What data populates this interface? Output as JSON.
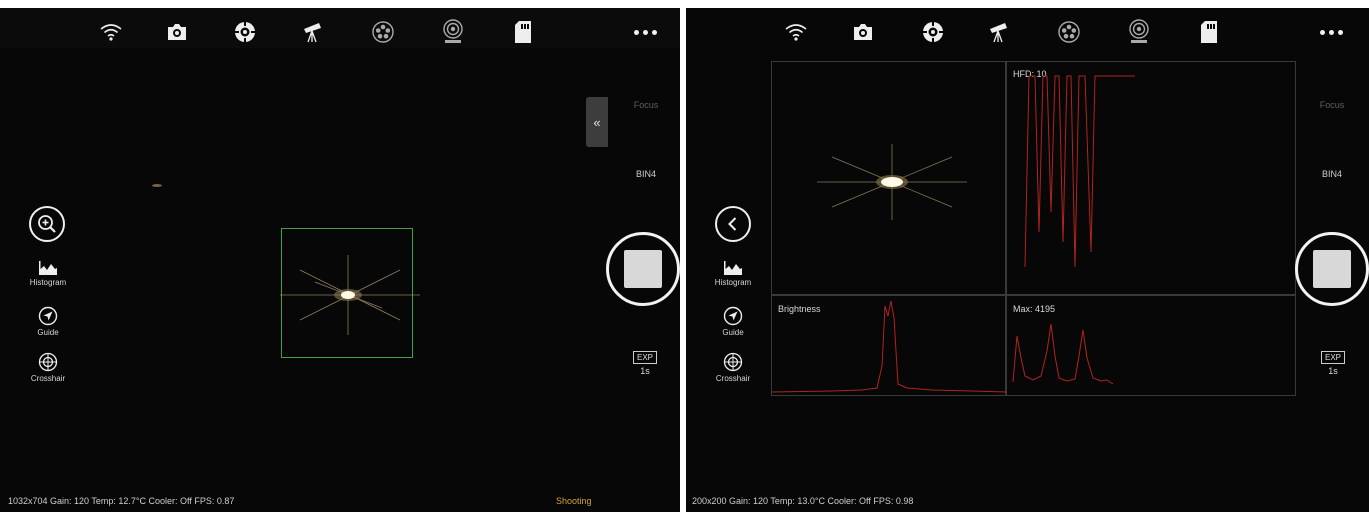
{
  "icons": {
    "wifi": "wifi-icon",
    "camera": "camera-icon",
    "focus_target": "crosshair-target-icon",
    "telescope": "telescope-icon",
    "filter_wheel": "filter-wheel-icon",
    "focuser": "focuser-icon",
    "sd_card": "sd-card-icon",
    "more": "more-icon"
  },
  "left_screen": {
    "tools": {
      "histogram": "Histogram",
      "guide": "Guide",
      "crosshair": "Crosshair"
    },
    "right_panel": {
      "focus": "Focus",
      "bin": "BIN4",
      "exp_label": "EXP",
      "exp_value": "1s"
    },
    "status": "1032x704  Gain: 120  Temp: 12.7°C  Cooler: Off  FPS: 0.87",
    "status_right": "Shooting"
  },
  "right_screen": {
    "tools": {
      "histogram": "Histogram",
      "guide": "Guide",
      "crosshair": "Crosshair"
    },
    "right_panel": {
      "focus": "Focus",
      "bin": "BIN4",
      "exp_label": "EXP",
      "exp_value": "1s"
    },
    "panels": {
      "hfd": "HFD: 10",
      "brightness": "Brightness",
      "max": "Max: 4195"
    },
    "status": "200x200  Gain: 120  Temp: 13.0°C  Cooler: Off  FPS: 0.98"
  },
  "colors": {
    "roi": "#3fa13f",
    "plot": "#b0241e",
    "accent": "#d7a42b"
  }
}
